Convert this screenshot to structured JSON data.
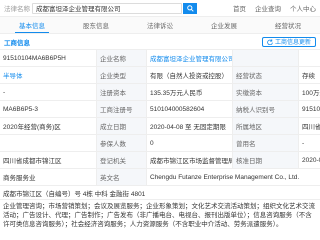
{
  "header": {
    "label": "法律名称",
    "search_value": "成都富坦泽企业管理有限公司",
    "nav": [
      "首页",
      "企业查询",
      "个人中心"
    ]
  },
  "tabs": [
    "基本信息",
    "股东信息",
    "法律诉讼",
    "企业发展",
    "经营状况"
  ],
  "section": {
    "title": "工商信息",
    "update_button": "工商信息更新"
  },
  "rows": [
    {
      "a": "91510104MA6B6P5H",
      "b": "企业名称",
      "c": "成都富坦泽企业管理有限公司",
      "d": "",
      "e": ""
    },
    {
      "a": "半导体",
      "b": "企业类型",
      "c": "有限（自然人投资或控股）",
      "d": "经营状态",
      "e": "存续"
    },
    {
      "a": "-",
      "b": "注册资本",
      "c": "135.35万元人民币",
      "d": "实缴资本",
      "e": "100万元"
    },
    {
      "a": "MA6B6P5-3",
      "b": "工商注册号",
      "c": "510104000582604",
      "d": "纳税人识别号",
      "e": "91510104MA"
    },
    {
      "a": "2020年经营(商务)区",
      "b": "成立日期",
      "c": "2020-04-08 至 无固定期限",
      "d": "所属地区",
      "e": "四川省"
    },
    {
      "a": "",
      "b": "参保人数",
      "c": "0",
      "d": "曾用名",
      "e": "-"
    },
    {
      "a": "四川省成都市锦江区",
      "b": "登记机关",
      "c": "成都市锦江区市场监督管理局",
      "d": "核准日期",
      "e": "2020-04-08"
    }
  ],
  "english_row": {
    "a": "商务服务业",
    "b": "英文名",
    "c": "Chengdu Futanze Enterprise Management Co., Ltd."
  },
  "address": "成都市锦江区（自编号）号 4栋 中科 金融街 4801",
  "scope": "企业管理咨询；市场营销策划；会议及展览服务；企业形象策划；文化艺术交流活动策划；组织文化艺术交流活动；广告设计、代理；广告制作；广告发布（非广播电台、电视台、报刊出版单位）；信息咨询服务（不含许可类信息咨询服务）；社会经济咨询服务；人力资源服务（不含职业中介活动、劳务派遣服务）。",
  "colors": {
    "accent": "#128bed",
    "label_bg": "#f5f7fa"
  }
}
